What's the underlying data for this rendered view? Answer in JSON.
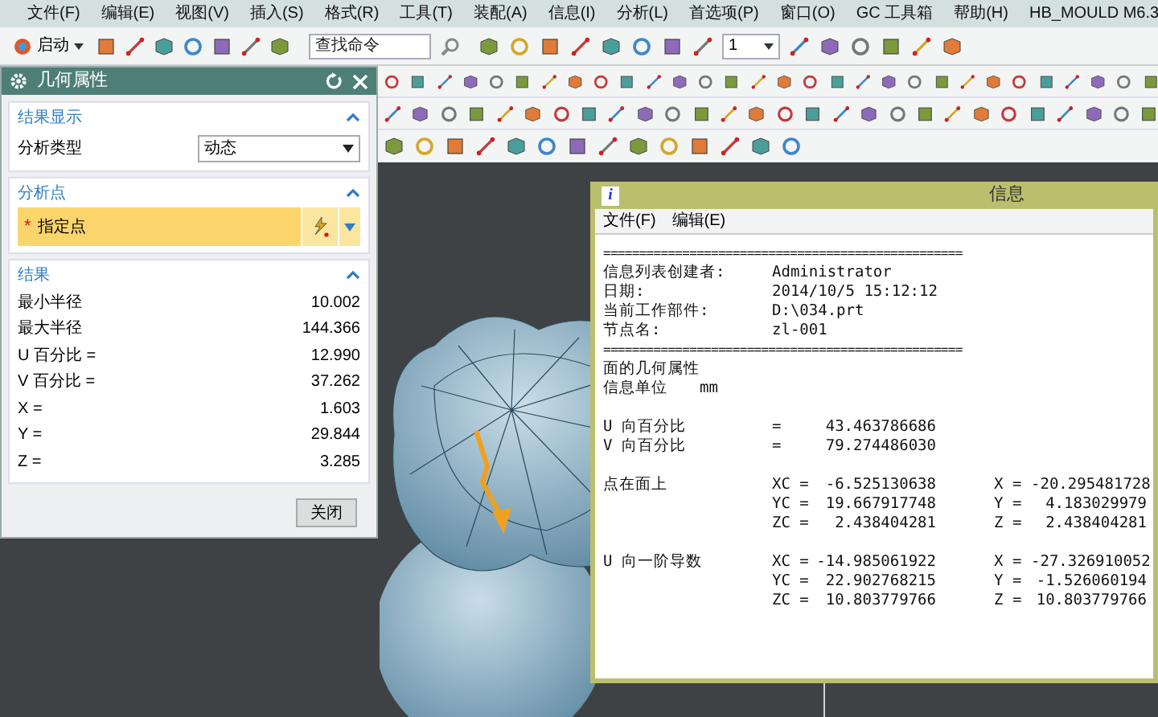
{
  "menu_bar": [
    "文件(F)",
    "编辑(E)",
    "视图(V)",
    "插入(S)",
    "格式(R)",
    "工具(T)",
    "装配(A)",
    "信息(I)",
    "分析(L)",
    "首选项(P)",
    "窗口(O)",
    "GC 工具箱",
    "帮助(H)",
    "HB_MOULD M6.3"
  ],
  "toolbar": {
    "start_button": "启动",
    "search": {
      "placeholder": "查找命令"
    },
    "layer_combo": "1"
  },
  "dialog": {
    "title": "几何属性",
    "sections": [
      {
        "kind": "display",
        "title": "结果显示",
        "expanded": true,
        "label": "分析类型",
        "value": "动态"
      },
      {
        "kind": "point",
        "title": "分析点",
        "expanded": true,
        "label": "指定点",
        "required_mark": "*"
      },
      {
        "kind": "results",
        "title": "结果",
        "expanded": true,
        "rows": [
          {
            "label": "最小半径",
            "value": "10.002"
          },
          {
            "label": "最大半径",
            "value": "144.366"
          },
          {
            "label": "U 百分比 =",
            "value": "12.990"
          },
          {
            "label": "V 百分比 =",
            "value": "37.262"
          },
          {
            "label": "X =",
            "value": "1.603"
          },
          {
            "label": "Y =",
            "value": "29.844"
          },
          {
            "label": "Z =",
            "value": "3.285"
          }
        ]
      }
    ],
    "close_button": "关闭"
  },
  "info_window": {
    "icon": "i",
    "title": "信息",
    "menu": [
      "文件(F)",
      "编辑(E)"
    ],
    "lines": [
      {
        "kind": "rule",
        "text": "=================================================="
      },
      {
        "kind": "field",
        "label": "信息列表创建者:",
        "value": "Administrator"
      },
      {
        "kind": "field",
        "label": "日期:",
        "value": "2014/10/5 15:12:12"
      },
      {
        "kind": "field",
        "label": "当前工作部件:",
        "value": "D:\\034.prt"
      },
      {
        "kind": "field",
        "label": "节点名:",
        "value": "zl-001"
      },
      {
        "kind": "rule",
        "text": "=================================================="
      },
      {
        "kind": "heading",
        "label": "面的几何属性"
      },
      {
        "kind": "unit",
        "label": "信息单位",
        "value": "mm"
      },
      {
        "kind": "spacer"
      },
      {
        "kind": "measure",
        "label": "U 向百分比",
        "key": "=",
        "value": "43.463786686"
      },
      {
        "kind": "measure",
        "label": "V 向百分比",
        "key": "=",
        "value": "79.274486030"
      },
      {
        "kind": "spacer"
      },
      {
        "kind": "measure",
        "label": "点在面上",
        "key": "XC =",
        "value": "-6.525130638",
        "key2": "X =",
        "value2": "-20.295481728"
      },
      {
        "kind": "measure",
        "key": "YC =",
        "value": "19.667917748",
        "key2": "Y =",
        "value2": "4.183029979"
      },
      {
        "kind": "measure",
        "key": "ZC =",
        "value": "2.438404281",
        "key2": "Z =",
        "value2": "2.438404281"
      },
      {
        "kind": "spacer"
      },
      {
        "kind": "measure",
        "label": "U 向一阶导数",
        "key": "XC =",
        "value": "-14.985061922",
        "key2": "X =",
        "value2": "-27.326910052"
      },
      {
        "kind": "measure",
        "key": "YC =",
        "value": "22.902768215",
        "key2": "Y =",
        "value2": "-1.526060194"
      },
      {
        "kind": "measure",
        "key": "ZC =",
        "value": "10.803779766",
        "key2": "Z =",
        "value2": "10.803779766"
      }
    ]
  }
}
